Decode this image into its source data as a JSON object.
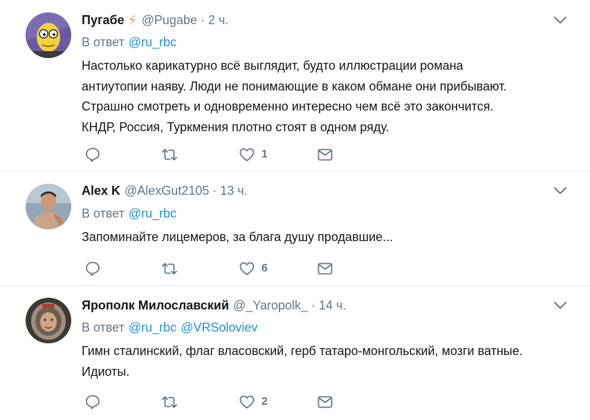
{
  "tweets": [
    {
      "name": "Пугабе",
      "badge": "⚡",
      "handle": "@Pugabe",
      "sep": "·",
      "time": "2 ч.",
      "reply_prefix": "В ответ",
      "mentions": [
        "@ru_rbc"
      ],
      "text_lines": [
        "Настолько карикатурно всё выглядит, будто иллюстрации романа",
        "антиутопии наяву. Люди не понимающие в каком обмане они прибывают.",
        "Страшно смотреть и одновременно интересно чем всё это закончится.",
        "КНДР, Россия, Туркмения плотно стоят в одном ряду."
      ],
      "likes": "1",
      "avatar_icon": "monocle-cartoon-avatar"
    },
    {
      "name": "Alex K",
      "handle": "@AlexGut2105",
      "sep": "·",
      "time": "13 ч.",
      "reply_prefix": "В ответ",
      "mentions": [
        "@ru_rbc"
      ],
      "text_lines": [
        "Запоминайте лицемеров, за блага душу продавшие..."
      ],
      "likes": "6",
      "avatar_icon": "man-photo-avatar"
    },
    {
      "name": "Ярополк Милославский",
      "handle": "@_Yaropolk_",
      "sep": "·",
      "time": "14 ч.",
      "reply_prefix": "В ответ",
      "mentions": [
        "@ru_rbc",
        "@VRSoloviev"
      ],
      "text_lines": [
        "Гимн сталинский, флаг власовский, герб татаро-монгольский, мозги ватные.",
        "Идиоты."
      ],
      "likes": "2",
      "avatar_icon": "cosmonaut-avatar"
    }
  ],
  "icons": {
    "reply": "reply-icon",
    "retweet": "retweet-icon",
    "like": "heart-icon",
    "dm": "envelope-icon",
    "more": "chevron-down-icon"
  },
  "colors": {
    "link": "#1b95e0",
    "secondary": "#657786",
    "text": "#14171a",
    "divider": "#e6ecf0"
  }
}
